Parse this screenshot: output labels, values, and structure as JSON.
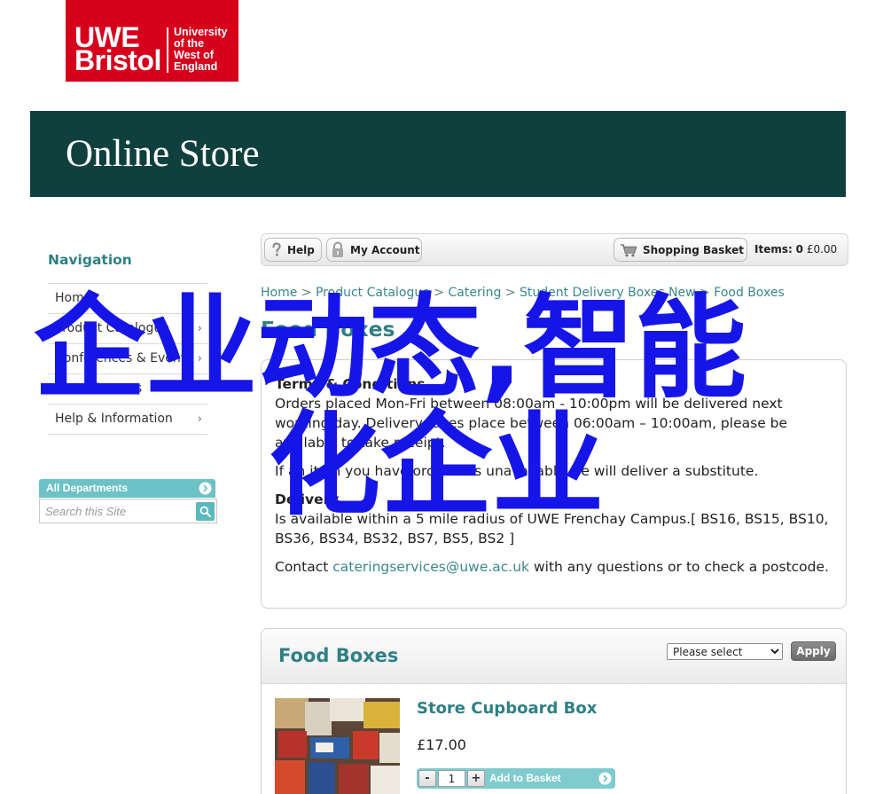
{
  "logo": {
    "line1": "UWE",
    "line2": "Bristol",
    "sub": [
      "University",
      "of the",
      "West of",
      "England"
    ]
  },
  "header": {
    "title": "Online Store"
  },
  "sidebar": {
    "heading": "Navigation",
    "items": [
      {
        "label": "Home",
        "has_submenu": false
      },
      {
        "label": "Product Catalogue",
        "has_submenu": true
      },
      {
        "label": "Conferences & Events",
        "has_submenu": true
      },
      {
        "label": "Short Courses",
        "has_submenu": true
      },
      {
        "label": "Help & Information",
        "has_submenu": true
      }
    ],
    "departments_label": "All Departments",
    "search_placeholder": "Search this Site"
  },
  "toolbar": {
    "help_label": "Help",
    "account_label": "My Account",
    "basket_label": "Shopping Basket",
    "items_label": "Items:",
    "items_count": "0",
    "basket_total": "£0.00"
  },
  "breadcrumb": {
    "separator": ">",
    "items": [
      "Home",
      "Product Catalogue",
      "Catering",
      "Student Delivery Boxes New",
      "Food Boxes"
    ]
  },
  "page_title": "Food Boxes",
  "info": {
    "terms_heading": "Terms & Conditions",
    "terms_text": "Orders placed Mon-Fri between 08:00am - 10:00pm will be delivered next working day. Delivery takes place between 06:00am – 10:00am, please be available to take receipt.",
    "substitute_text": "If an item you have ordered is unavailable we will deliver a substitute.",
    "delivery_heading": "Delivery",
    "delivery_text": "Is available within a 5 mile radius of UWE Frenchay Campus.[ BS16, BS15, BS10, BS36, BS34, BS32, BS7, BS5, BS2 ]",
    "contact_prefix": "Contact",
    "contact_email": "cateringservices@uwe.ac.uk",
    "contact_suffix": "with any questions or to check a postcode."
  },
  "food_boxes": {
    "heading": "Food Boxes",
    "sort_selected": "Please select",
    "apply_label": "Apply",
    "products": [
      {
        "name": "Store Cupboard Box",
        "price": "£17.00",
        "quantity": "1",
        "decrement_label": "-",
        "increment_label": "+",
        "add_label": "Add to Basket"
      }
    ]
  },
  "overlay": {
    "line1": "企业动态,智能",
    "line2": "化企业"
  },
  "icons": {
    "help": "help-icon",
    "account": "lock-icon",
    "basket": "shopping-cart-icon",
    "search": "search-icon",
    "nav_submenu": "chevron-right-icon",
    "departments": "circle-arrow-icon",
    "add_to_basket": "circle-arrow-icon"
  },
  "colors": {
    "brand_red": "#d6001c",
    "header_bg": "#0f403e",
    "teal": "#2e8085",
    "link_teal": "#3a878b",
    "accent_teal": "#6cc2c6",
    "overlay_blue": "#1515e8"
  }
}
